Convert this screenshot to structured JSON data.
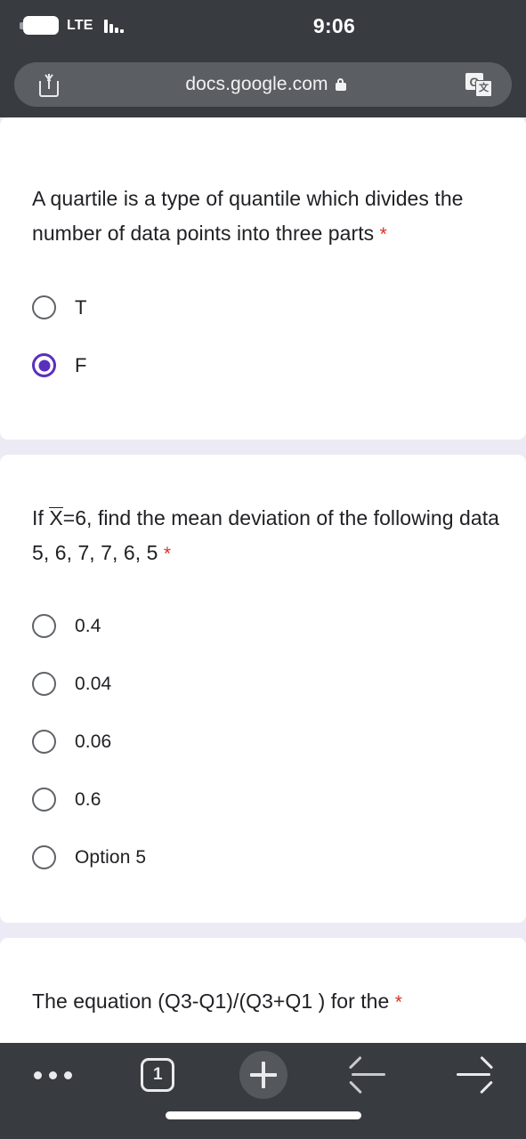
{
  "status_bar": {
    "carrier": "LTE",
    "time": "9:06",
    "battery_icon": "battery-full-icon",
    "signal_icon": "signal-bars-icon"
  },
  "browser": {
    "url": "docs.google.com",
    "lock_icon": "lock-icon",
    "share_icon": "share-icon",
    "translate_icon": "google-translate-icon",
    "translate_glyph_primary": "G",
    "translate_glyph_secondary": "文"
  },
  "form": {
    "required_marker": "*",
    "questions": [
      {
        "text": "A quartile is a type of quantile which divides the number of data points into three parts",
        "required": true,
        "options": [
          {
            "label": "T",
            "selected": false
          },
          {
            "label": "F",
            "selected": true
          }
        ]
      },
      {
        "prefix": "If ",
        "overline_symbol": "X",
        "text": "=6, find the mean deviation of the following data 5, 6, 7, 7, 6, 5",
        "required": true,
        "options": [
          {
            "label": "0.4",
            "selected": false
          },
          {
            "label": "0.04",
            "selected": false
          },
          {
            "label": "0.06",
            "selected": false
          },
          {
            "label": "0.6",
            "selected": false
          },
          {
            "label": "Option 5",
            "selected": false
          }
        ]
      },
      {
        "text": "The equation (Q3-Q1)/(Q3+Q1 ) for the",
        "required": true,
        "options": []
      }
    ]
  },
  "toolbar": {
    "menu_label": "•••",
    "tab_count": "1",
    "new_tab_label": "+",
    "back_label": "←",
    "forward_label": "→"
  },
  "colors": {
    "chrome": "#383b40",
    "url_pill": "#5b5e63",
    "page_background": "#eceaf4",
    "card": "#ffffff",
    "accent_purple": "#5b2ebd",
    "required_red": "#d93025",
    "text": "#202124"
  }
}
